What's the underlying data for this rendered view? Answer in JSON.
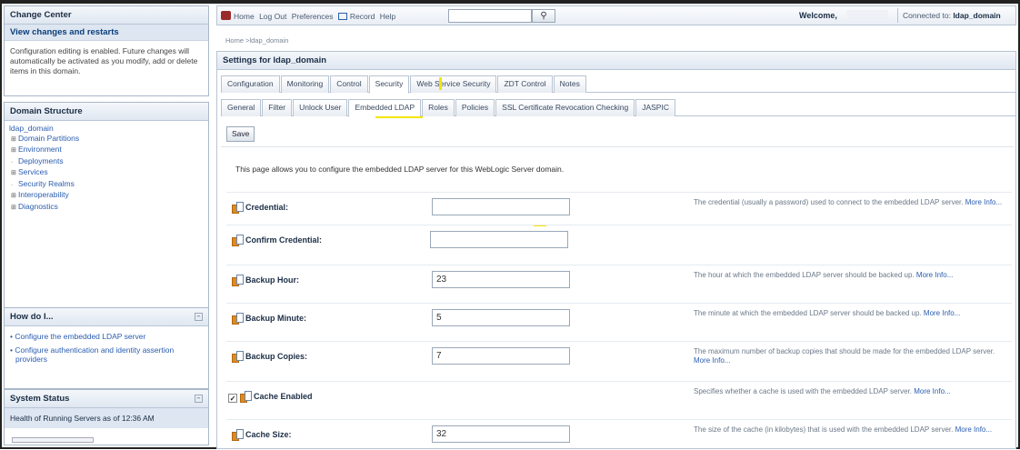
{
  "left": {
    "change_center": {
      "title": "Change Center",
      "link": "View changes and restarts",
      "text": "Configuration editing is enabled. Future changes will automatically be activated as you modify, add or delete items in this domain."
    },
    "domain_structure": {
      "title": "Domain Structure",
      "items": [
        "ldap_domain",
        "Domain Partitions",
        "Environment",
        "Deployments",
        "Services",
        "Security Realms",
        "Interoperability",
        "Diagnostics"
      ]
    },
    "how_do_i": {
      "title": "How do I...",
      "items": [
        "Configure the embedded LDAP server",
        "Configure authentication and identity assertion providers"
      ]
    },
    "system_status": {
      "title": "System Status",
      "text": "Health of Running Servers as of  12:36 AM"
    }
  },
  "topbar": {
    "home": "Home",
    "logout": "Log Out",
    "preferences": "Preferences",
    "record": "Record",
    "help": "Help",
    "search_value": "",
    "welcome": "Welcome,",
    "connected_label": "Connected to:",
    "connected_domain": "ldap_domain"
  },
  "breadcrumb": "Home >ldap_domain",
  "settings": {
    "title": "Settings for ldap_domain",
    "tabs1": [
      "Configuration",
      "Monitoring",
      "Control",
      "Security",
      "Web Service Security",
      "ZDT Control",
      "Notes"
    ],
    "tabs2": [
      "General",
      "Filter",
      "Unlock User",
      "Embedded LDAP",
      "Roles",
      "Policies",
      "SSL Certificate Revocation Checking",
      "JASPIC"
    ],
    "save": "Save",
    "intro": "This page allows you to configure the embedded LDAP server for this WebLogic Server domain.",
    "fields": [
      {
        "label": "Credential:",
        "value": "",
        "desc": "The credential (usually a password) used to connect to the embedded LDAP server.",
        "more": "More Info..."
      },
      {
        "label": "Confirm Credential:",
        "value": "",
        "desc": "",
        "more": ""
      },
      {
        "label": "Backup Hour:",
        "value": "23",
        "desc": "The hour at which the embedded LDAP server should be backed up.",
        "more": "More Info..."
      },
      {
        "label": "Backup Minute:",
        "value": "5",
        "desc": "The minute at which the embedded LDAP server should be backed up.",
        "more": "More Info..."
      },
      {
        "label": "Backup Copies:",
        "value": "7",
        "desc": "The maximum number of backup copies that should be made for the embedded LDAP server.",
        "more": "More Info..."
      },
      {
        "label": "Cache Enabled",
        "checked": true,
        "desc": "Specifies whether a cache is used with the embedded LDAP server.",
        "more": "More Info..."
      },
      {
        "label": "Cache Size:",
        "value": "32",
        "desc": "The size of the cache (in kilobytes) that is used with the embedded LDAP server.",
        "more": "More Info..."
      }
    ]
  }
}
